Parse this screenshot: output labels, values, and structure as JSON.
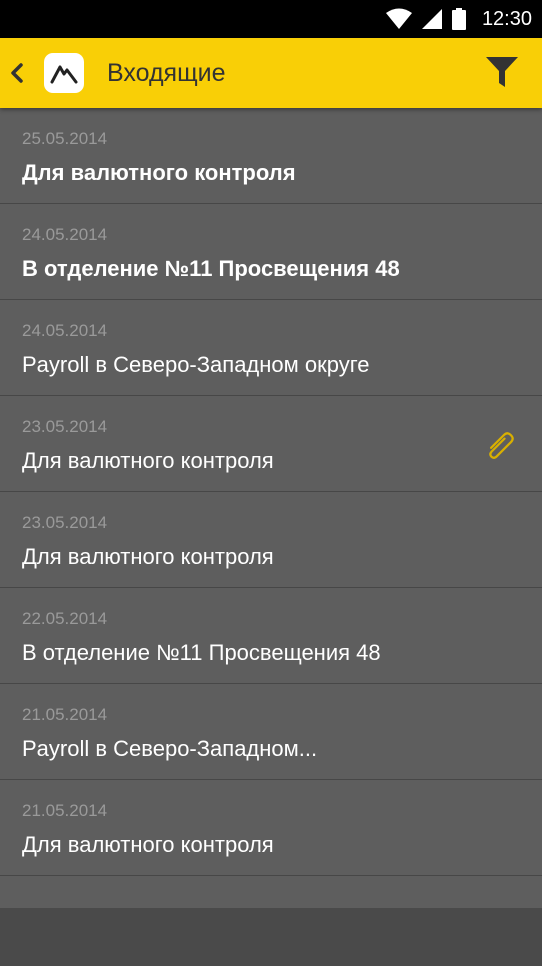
{
  "status_bar": {
    "time": "12:30"
  },
  "app_bar": {
    "title": "Входящие"
  },
  "messages": [
    {
      "date": "25.05.2014",
      "subject": "Для валютного контроля"
    },
    {
      "date": "24.05.2014",
      "subject": "В отделение №11 Просвещения 48"
    },
    {
      "date": "24.05.2014",
      "subject": "Payroll в Северо-Западном округе"
    },
    {
      "date": "23.05.2014",
      "subject": "Для валютного контроля"
    },
    {
      "date": "23.05.2014",
      "subject": "Для валютного контроля"
    },
    {
      "date": "22.05.2014",
      "subject": "В отделение №11 Просвещения 48"
    },
    {
      "date": "21.05.2014",
      "subject": "Payroll в Северо-Западном..."
    },
    {
      "date": "21.05.2014",
      "subject": "Для валютного контроля"
    }
  ],
  "colors": {
    "accent": "#f9cf06",
    "list_bg": "#5e5e5e",
    "divider": "#474747",
    "attachment": "#d9b000"
  }
}
